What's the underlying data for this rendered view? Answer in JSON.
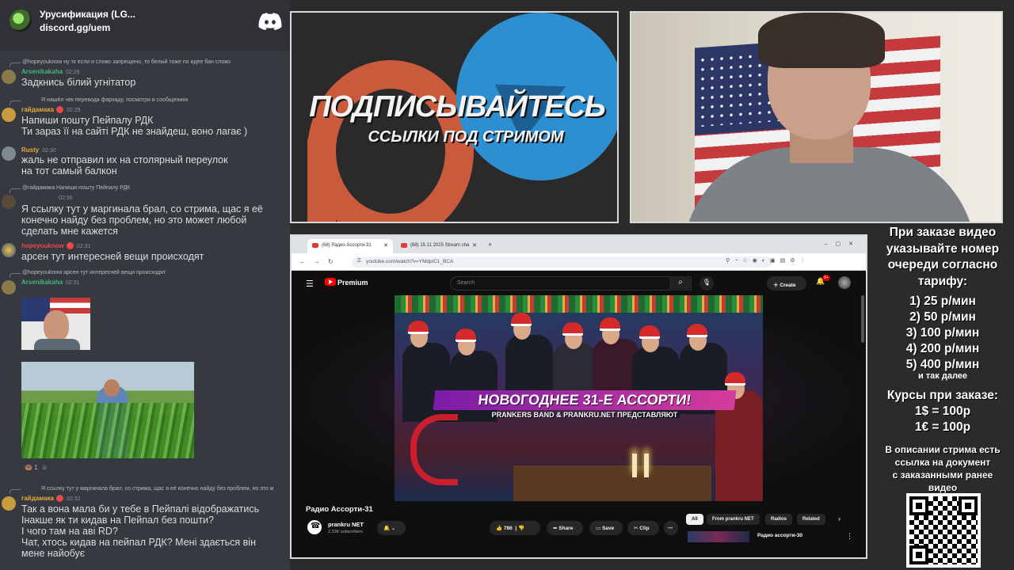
{
  "chat": {
    "server_name": "Урусификация (LG...",
    "server_invite": "discord.gg/uem",
    "messages": [
      {
        "reply_to": "@hopeyouknow  ну тк если и слово запрещено, то белый тоже по идее бан слово",
        "author": "Arsenikakaha",
        "time": "02:29",
        "text": "Задкнись білий угнітатор",
        "author_color": "#43b581"
      },
      {
        "reply_to": "Я нашёл чек перевода фархаду, посмотри в сообщениях",
        "author": "гайдамака",
        "time": "02:29",
        "text": "Напиши пошту Пейпалу РДК\nТи зараз її на сайті РДК не знайдеш, воно лагає )",
        "author_color": "#e8a93a"
      },
      {
        "reply_to": "",
        "author": "Rusty",
        "time": "02:30",
        "text": "жаль не отправил их на столярный переулок\nна тот самый балкон",
        "author_color": "#e8a93a"
      },
      {
        "reply_to": "@гайдамака  Напиши пошту Пейпалу РДК",
        "author": "",
        "time": "02:30",
        "text": "Я ссылку тут у маргинала брал, со стрима, щас я её\nконечно найду без проблем, но это может любой\nсделать мне кажется",
        "author_color": "#dcddde"
      },
      {
        "reply_to": "",
        "author": "hopeyouknow",
        "time": "02:31",
        "text": "арсен тут интересней вещи происходят",
        "author_color": "#f04747"
      },
      {
        "reply_to": "@hopeyouknow  арсен тут интересней вещи происходят",
        "author": "Arsenikakaha",
        "time": "02:31",
        "text": "",
        "author_color": "#43b581"
      },
      {
        "reply_to": "Я ссылку тут у маргинала брал, со стрима, щас я её конечно найду без проблем, но это м",
        "author": "гайдамака",
        "time": "02:32",
        "text": "Так а вона мала би у тебе в Пейпалі відображатись\nІнакше як ти кидав на Пейпал без пошти?\nІ чого там на аві RD?\nЧат, хтось кидав на пейпал РДК? Мені здається він\nмене найобує",
        "author_color": "#e8a93a"
      }
    ],
    "reactions": "1"
  },
  "banner": {
    "title": "ПОДПИСЫВАЙТЕСЬ",
    "subtitle": "ССЫЛКИ ПОД СТРИМОМ"
  },
  "browser": {
    "tabs": [
      {
        "label": "(68) Радио Ассорти-31"
      },
      {
        "label": "(68) 15.11.2025 Stream cha"
      }
    ],
    "url": "youtube.com/watch?v=YMdpiC1_BCA",
    "youtube": {
      "brand": "Premium",
      "search_placeholder": "Search",
      "create_label": "Create",
      "notif_count": "9+",
      "video_overlay_title": "НОВОГОДНЕЕ 31-Е АССОРТИ!",
      "video_overlay_sub": "PRANKERS BAND & PRANKRU.NET ПРЕДСТАВЛЯЮТ",
      "video_title": "Радио Ассорти-31",
      "channel_name": "prankru NET",
      "channel_subs": "2.33K subscribers",
      "likes": "786",
      "share_label": "Share",
      "save_label": "Save",
      "clip_label": "Clip",
      "chips": [
        "All",
        "From prankru NET",
        "Radios",
        "Related"
      ],
      "related_title": "Радио ассорти-30"
    }
  },
  "info": {
    "order_title": "При заказе видео\nуказывайте номер\nочереди согласно\nтарифу:",
    "prices": [
      "1) 25 р/мин",
      "2) 50 р/мин",
      "3) 100 р/мин",
      "4) 200 р/мин",
      "5) 400 р/мин"
    ],
    "etc": "и так далее",
    "rates_title": "Курсы при заказе:",
    "rates": [
      "1$ = 100р",
      "1€ = 100р"
    ],
    "desc_note": "В описании стрима есть\nссылка на документ\nс заказанными ранее\nвидео"
  },
  "colors": {
    "discord_bg": "#36393f",
    "page_bg": "#2b2b2b",
    "youtube_red": "#ff0000",
    "telegram_blue": "#2e8fd0",
    "rutube_orange": "#c95a3b"
  }
}
